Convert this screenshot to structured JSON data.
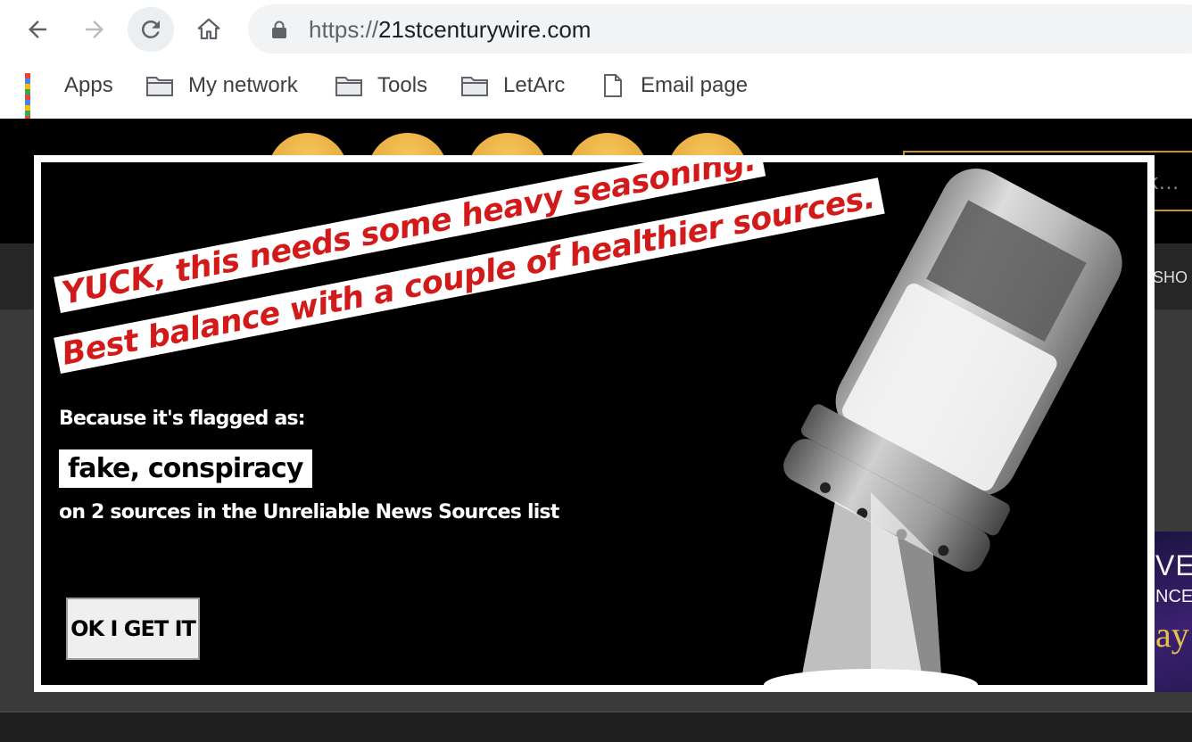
{
  "browser": {
    "url_scheme": "https://",
    "url_host": "21stcenturywire.com",
    "nav_icons": [
      "back-arrow-icon",
      "forward-arrow-icon",
      "reload-icon",
      "home-icon"
    ],
    "bookmarks": [
      {
        "label": "Apps",
        "icon": "apps-grid-icon"
      },
      {
        "label": "My network",
        "icon": "folder-icon"
      },
      {
        "label": "Tools",
        "icon": "folder-icon"
      },
      {
        "label": "LetArc",
        "icon": "folder-icon"
      },
      {
        "label": "Email page",
        "icon": "page-icon"
      }
    ]
  },
  "site": {
    "search_placeholder_visible": "ck…",
    "nav_item_partial": "SHO",
    "thumb_text": [
      "VE",
      "NCE",
      "ay"
    ]
  },
  "modal": {
    "headline_line1": "YUCK, this needs some heavy seasoning.",
    "headline_line2": "Best balance with a couple of healthier sources.",
    "flag_intro": "Because it's flagged as:",
    "flag_labels": "fake, conspiracy",
    "flag_tail": "on 2 sources in the Unreliable News Sources list",
    "ok_button": "OK I GET IT",
    "illustration": "salt-shaker-illustration"
  },
  "colors": {
    "headline_red": "#d21a1a",
    "modal_bg": "#000000",
    "site_accent": "#e3a93c"
  }
}
